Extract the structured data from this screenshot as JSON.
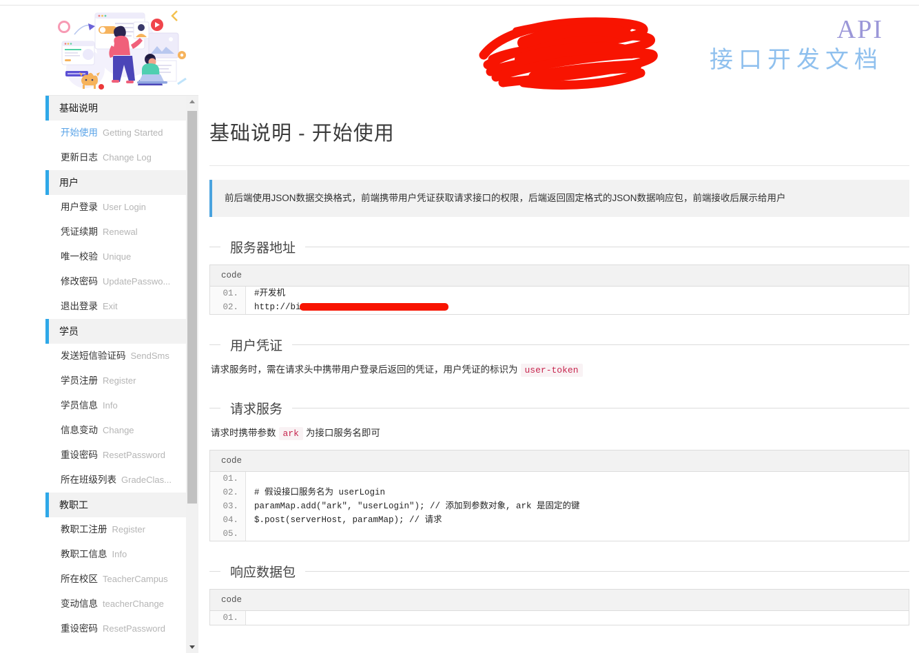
{
  "header": {
    "title_en": "API",
    "title_cn": "接口开发文档",
    "redaction_note": "redacted-red-scribble"
  },
  "sidebar": {
    "illustration_name": "team-working-illustration",
    "groups": [
      {
        "title": "基础说明",
        "items": [
          {
            "cn": "开始使用",
            "en": "Getting Started",
            "active": true
          },
          {
            "cn": "更新日志",
            "en": "Change Log",
            "active": false
          }
        ]
      },
      {
        "title": "用户",
        "items": [
          {
            "cn": "用户登录",
            "en": "User Login",
            "active": false
          },
          {
            "cn": "凭证续期",
            "en": "Renewal",
            "active": false
          },
          {
            "cn": "唯一校验",
            "en": "Unique",
            "active": false
          },
          {
            "cn": "修改密码",
            "en": "UpdatePasswo...",
            "active": false
          },
          {
            "cn": "退出登录",
            "en": "Exit",
            "active": false
          }
        ]
      },
      {
        "title": "学员",
        "items": [
          {
            "cn": "发送短信验证码",
            "en": "SendSms",
            "active": false
          },
          {
            "cn": "学员注册",
            "en": "Register",
            "active": false
          },
          {
            "cn": "学员信息",
            "en": "Info",
            "active": false
          },
          {
            "cn": "信息变动",
            "en": "Change",
            "active": false
          },
          {
            "cn": "重设密码",
            "en": "ResetPassword",
            "active": false
          },
          {
            "cn": "所在班级列表",
            "en": "GradeClas...",
            "active": false
          }
        ]
      },
      {
        "title": "教职工",
        "items": [
          {
            "cn": "教职工注册",
            "en": "Register",
            "active": false
          },
          {
            "cn": "教职工信息",
            "en": "Info",
            "active": false
          },
          {
            "cn": "所在校区",
            "en": "TeacherCampus",
            "active": false
          },
          {
            "cn": "变动信息",
            "en": "teacherChange",
            "active": false
          },
          {
            "cn": "重设密码",
            "en": "ResetPassword",
            "active": false
          }
        ]
      }
    ],
    "scrollbar": {
      "up_arrow": "scroll-up-arrow",
      "down_arrow": "scroll-down-arrow"
    }
  },
  "main": {
    "page_title": "基础说明 - 开始使用",
    "callout": "前后端使用JSON数据交换格式，前端携带用户凭证获取请求接口的权限，后端返回固定格式的JSON数据响应包，前端接收后展示给用户",
    "sections": [
      {
        "legend": "服务器地址",
        "code": {
          "label": "code",
          "lines": [
            {
              "no": "01.",
              "text": "#开发机"
            },
            {
              "no": "02.",
              "text": "http://bi",
              "redacted": true,
              "redact_width": 216
            }
          ]
        }
      },
      {
        "legend": "用户凭证",
        "paragraph_prefix": "请求服务时，需在请求头中携带用户登录后返回的凭证，用户凭证的标识为",
        "paragraph_code": "user-token",
        "paragraph_suffix": ""
      },
      {
        "legend": "请求服务",
        "paragraph_prefix": "请求时携带参数",
        "paragraph_code": "ark",
        "paragraph_suffix": "为接口服务名即可",
        "code": {
          "label": "code",
          "lines": [
            {
              "no": "01.",
              "text": ""
            },
            {
              "no": "02.",
              "text": "# 假设接口服务名为 userLogin"
            },
            {
              "no": "03.",
              "text": "paramMap.add(\"ark\", \"userLogin\"); // 添加到参数对象, ark 是固定的键"
            },
            {
              "no": "04.",
              "text": "$.post(serverHost, paramMap); // 请求"
            },
            {
              "no": "05.",
              "text": ""
            }
          ]
        }
      },
      {
        "legend": "响应数据包",
        "code": {
          "label": "code",
          "lines": [
            {
              "no": "01.",
              "text": ""
            }
          ]
        }
      }
    ]
  },
  "colors": {
    "accent_blue": "#2fa8e8",
    "callout_border": "#4aa3df",
    "active_link": "#5ba4e8",
    "inline_code_text": "#c7254e",
    "inline_code_bg": "#f9f2f4",
    "redaction_red": "#f81401",
    "title_en": "#9b97d8",
    "title_cn": "#8fc0ee"
  }
}
